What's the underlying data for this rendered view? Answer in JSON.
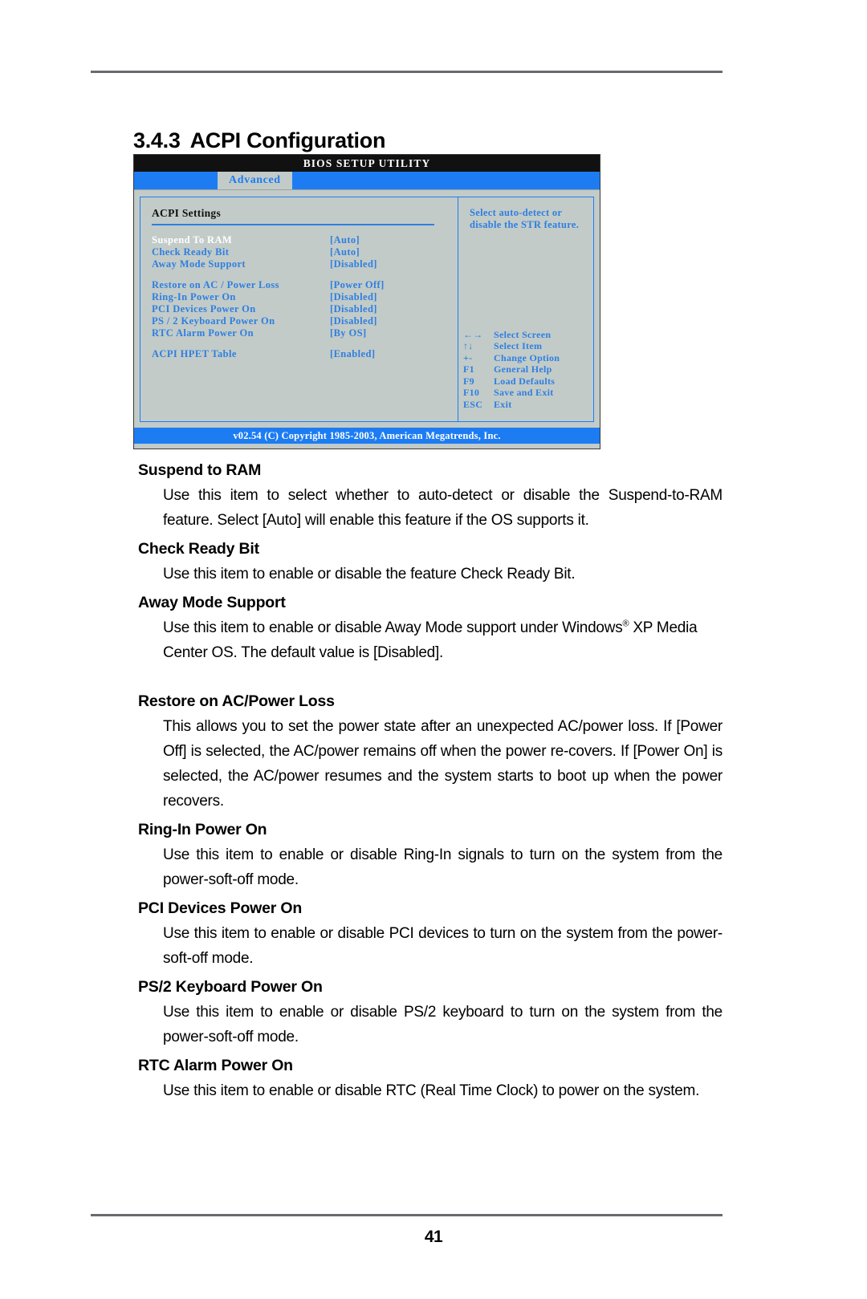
{
  "section": {
    "number": "3.4.3",
    "title": "ACPI Configuration"
  },
  "bios": {
    "title": "BIOS SETUP UTILITY",
    "active_tab": "Advanced",
    "panel_heading": "ACPI Settings",
    "settings": [
      {
        "label": "Suspend To RAM",
        "value": "[Auto]",
        "selected": true
      },
      {
        "label": "Check Ready Bit",
        "value": "[Auto]",
        "selected": false
      },
      {
        "label": "Away Mode Support",
        "value": "[Disabled]",
        "selected": false
      }
    ],
    "settings_group2": [
      {
        "label": "Restore on AC / Power Loss",
        "value": "[Power Off]",
        "selected": false
      },
      {
        "label": "Ring-In Power On",
        "value": "[Disabled]",
        "selected": false
      },
      {
        "label": "PCI Devices Power On",
        "value": "[Disabled]",
        "selected": false
      },
      {
        "label": "PS / 2 Keyboard Power On",
        "value": "[Disabled]",
        "selected": false
      },
      {
        "label": "RTC Alarm Power On",
        "value": "[By OS]",
        "selected": false
      }
    ],
    "settings_group3": [
      {
        "label": "ACPI HPET Table",
        "value": "[Enabled]",
        "selected": false
      }
    ],
    "help_text": "Select auto-detect or disable the STR feature.",
    "key_legend": [
      {
        "key": "←→",
        "desc": "Select Screen"
      },
      {
        "key": "↑↓",
        "desc": "Select Item"
      },
      {
        "key": "+-",
        "desc": "Change Option"
      },
      {
        "key": "F1",
        "desc": "General Help"
      },
      {
        "key": "F9",
        "desc": "Load Defaults"
      },
      {
        "key": "F10",
        "desc": "Save and Exit"
      },
      {
        "key": "ESC",
        "desc": "Exit"
      }
    ],
    "footer": "v02.54 (C) Copyright 1985-2003, American Megatrends, Inc.",
    "colors": {
      "accent_blue": "#1d7cf2",
      "text_blue": "#2f7fe0",
      "panel_bg": "#c2cbc8",
      "titlebar_bg": "#111111",
      "selected_label": "#ffffff"
    }
  },
  "content": [
    {
      "term": "Suspend to RAM",
      "description": "Use this item to select whether to auto-detect or disable the Suspend-to-RAM feature. Select [Auto] will enable this feature if the OS supports it."
    },
    {
      "term": "Check Ready Bit",
      "description": "Use this item to enable or disable the feature Check Ready Bit."
    },
    {
      "term": "Away Mode Support",
      "description_pre": "Use this item to enable or disable Away Mode support under Windows",
      "description_post": " XP Media Center OS. The default value is [Disabled].",
      "registered_mark": "®"
    },
    {
      "term": "Restore on AC/Power Loss",
      "description": "This allows you to set the power state after an unexpected AC/power loss. If [Power Off] is selected, the AC/power remains off when the power re-covers. If [Power On] is selected, the AC/power resumes and the system starts to boot up when the power recovers."
    },
    {
      "term": "Ring-In Power On",
      "description": "Use this item to enable or disable Ring-In signals to turn on the system from the power-soft-off mode."
    },
    {
      "term": "PCI Devices Power On",
      "description": "Use this item to enable or disable PCI devices to turn on the system from the power-soft-off mode."
    },
    {
      "term": "PS/2 Keyboard Power On",
      "description": "Use this item to enable or disable PS/2 keyboard to turn on the system from the power-soft-off mode."
    },
    {
      "term": "RTC Alarm Power On",
      "description": "Use this item to enable or disable RTC (Real Time Clock) to power on the system."
    }
  ],
  "page_number": "41"
}
